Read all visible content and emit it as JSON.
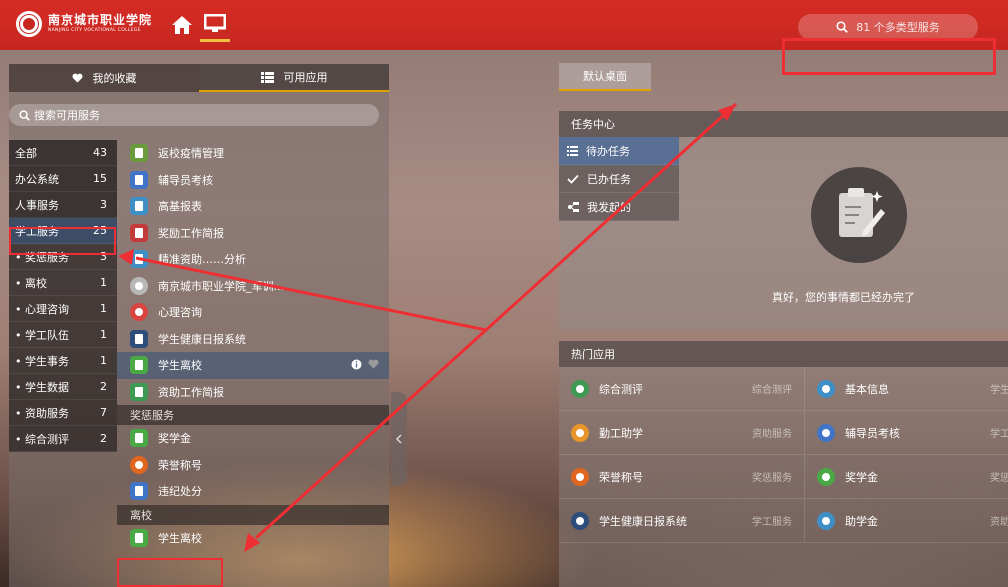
{
  "header": {
    "logo_cn": "南京城市职业学院",
    "logo_en": "NANJING CITY VOCATIONAL COLLEGE",
    "search_label": "81 个多类型服务"
  },
  "left": {
    "tabs": {
      "favorites": "我的收藏",
      "apps": "可用应用"
    },
    "search_placeholder": "搜索可用服务",
    "categories": [
      {
        "label": "全部",
        "count": "43",
        "kind": "main"
      },
      {
        "label": "办公系统",
        "count": "15",
        "kind": "main"
      },
      {
        "label": "人事服务",
        "count": "3",
        "kind": "main"
      },
      {
        "label": "学工服务",
        "count": "25",
        "kind": "main",
        "active": true
      },
      {
        "label": "• 奖惩服务",
        "count": "3",
        "kind": "sub"
      },
      {
        "label": "• 离校",
        "count": "1",
        "kind": "sub"
      },
      {
        "label": "• 心理咨询",
        "count": "1",
        "kind": "sub"
      },
      {
        "label": "• 学工队伍",
        "count": "1",
        "kind": "sub"
      },
      {
        "label": "• 学生事务",
        "count": "1",
        "kind": "sub"
      },
      {
        "label": "• 学生数据",
        "count": "2",
        "kind": "sub"
      },
      {
        "label": "• 资助服务",
        "count": "7",
        "kind": "sub"
      },
      {
        "label": "• 综合测评",
        "count": "2",
        "kind": "sub"
      }
    ],
    "apps": [
      {
        "label": "返校疫情管理",
        "color": "#6a9c3c"
      },
      {
        "label": "辅导员考核",
        "color": "#3f74c7"
      },
      {
        "label": "高基报表",
        "color": "#3f8fc7"
      },
      {
        "label": "奖励工作简报",
        "color": "#c43a3a"
      },
      {
        "label": "精准资助……分析",
        "color": "#3f8fc7"
      },
      {
        "label": "南京城市职业学院_军训...",
        "color": "#b8b8b8",
        "round": true
      },
      {
        "label": "心理咨询",
        "color": "#d9443f",
        "round": true
      },
      {
        "label": "学生健康日报系统",
        "color": "#2d4e7a"
      },
      {
        "label": "学生离校",
        "color": "#4aa845",
        "highlight": true
      },
      {
        "label": "资助工作简报",
        "color": "#3e9a52"
      }
    ],
    "section_reward": "奖惩服务",
    "reward_apps": [
      {
        "label": "奖学金",
        "color": "#4aa845"
      },
      {
        "label": "荣誉称号",
        "color": "#e0651f",
        "round": true
      },
      {
        "label": "违纪处分",
        "color": "#3f74c7"
      }
    ],
    "section_leave": "离校",
    "leave_apps": [
      {
        "label": "学生离校",
        "color": "#4aa845"
      }
    ]
  },
  "right": {
    "desktop_tab": "默认桌面",
    "task_center": {
      "title": "任务中心",
      "items": [
        "待办任务",
        "已办任务",
        "我发起的"
      ],
      "empty_message": "真好，您的事情都已经办完了"
    },
    "hot_apps": {
      "title": "热门应用",
      "rows": [
        [
          {
            "name": "综合测评",
            "category": "综合测评",
            "color": "#3e9a52"
          },
          {
            "name": "基本信息",
            "category": "学生",
            "color": "#3f8fc7"
          }
        ],
        [
          {
            "name": "勤工助学",
            "category": "资助服务",
            "color": "#e8952c"
          },
          {
            "name": "辅导员考核",
            "category": "学工",
            "color": "#3f74c7"
          }
        ],
        [
          {
            "name": "荣誉称号",
            "category": "奖惩服务",
            "color": "#e0651f"
          },
          {
            "name": "奖学金",
            "category": "奖惩",
            "color": "#4aa845"
          }
        ],
        [
          {
            "name": "学生健康日报系统",
            "category": "学工服务",
            "color": "#2d4e7a"
          },
          {
            "name": "助学金",
            "category": "资助",
            "color": "#3f8fc7"
          }
        ]
      ]
    }
  },
  "colors": {
    "topbar": "#d62c25",
    "accent": "#e0a100",
    "annotation": "#ef2e33"
  }
}
